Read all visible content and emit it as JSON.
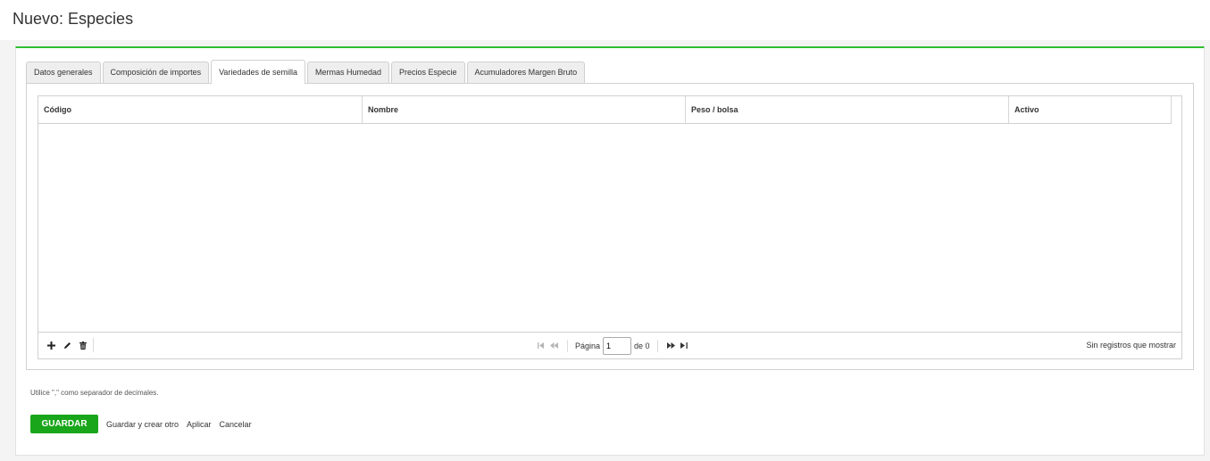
{
  "header": {
    "title": "Nuevo: Especies"
  },
  "tabs": [
    {
      "label": "Datos generales"
    },
    {
      "label": "Composición de importes"
    },
    {
      "label": "Variedades de semilla",
      "active": true
    },
    {
      "label": "Mermas Humedad"
    },
    {
      "label": "Precios Especie"
    },
    {
      "label": "Acumuladores Margen Bruto"
    }
  ],
  "grid": {
    "columns": [
      {
        "label": "Código"
      },
      {
        "label": "Nombre"
      },
      {
        "label": "Peso / bolsa"
      },
      {
        "label": "Activo"
      }
    ],
    "rows": []
  },
  "pager": {
    "page_label": "Página",
    "page_value": "1",
    "of_label": "de 0",
    "info": "Sin registros que mostrar",
    "icons": [
      "add-icon",
      "edit-icon",
      "delete-icon",
      "first-page-icon",
      "prev-page-icon",
      "next-page-icon",
      "last-page-icon"
    ]
  },
  "hint": "Utilice \",\" como separador de decimales.",
  "actions": {
    "save": "GUARDAR",
    "save_new": "Guardar y crear otro",
    "apply": "Aplicar",
    "cancel": "Cancelar"
  },
  "colors": {
    "accent": "#2fbf2f",
    "save_button": "#1aa61a"
  }
}
